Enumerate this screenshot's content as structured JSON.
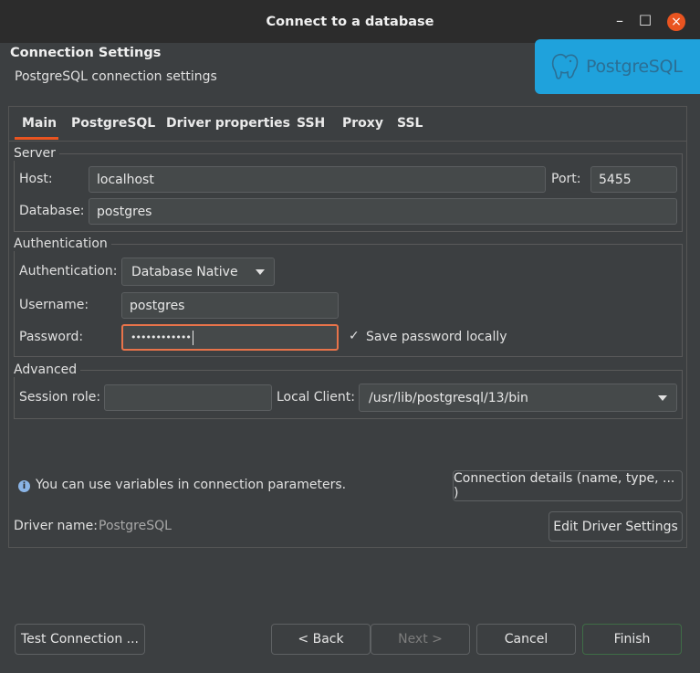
{
  "window": {
    "title": "Connect to a database",
    "minimize_glyph": "–",
    "maximize_glyph": "□",
    "close_glyph": "×"
  },
  "header": {
    "title": "Connection Settings",
    "subtitle": "PostgreSQL connection settings",
    "logo_text": "PostgreSQL",
    "logo_color": "#1fa2dc"
  },
  "tabs": [
    {
      "label": "Main",
      "active": true
    },
    {
      "label": "PostgreSQL"
    },
    {
      "label": "Driver properties"
    },
    {
      "label": "SSH"
    },
    {
      "label": "Proxy"
    },
    {
      "label": "SSL"
    }
  ],
  "server": {
    "group_label": "Server",
    "host_label": "Host:",
    "host_value": "localhost",
    "port_label": "Port:",
    "port_value": "5455",
    "database_label": "Database:",
    "database_value": "postgres"
  },
  "auth": {
    "group_label": "Authentication",
    "auth_label": "Authentication:",
    "auth_value": "Database Native",
    "username_label": "Username:",
    "username_value": "postgres",
    "password_label": "Password:",
    "password_value": "••••••••••••",
    "save_password_label": "Save password locally",
    "save_password_checked": true
  },
  "advanced": {
    "group_label": "Advanced",
    "session_role_label": "Session role:",
    "session_role_value": "",
    "local_client_label": "Local Client:",
    "local_client_value": "/usr/lib/postgresql/13/bin"
  },
  "info": {
    "text": "You can use variables in connection parameters.",
    "connection_details_button": "Connection details (name, type, ... )"
  },
  "driver": {
    "label": "Driver name:",
    "value": "PostgreSQL",
    "edit_button": "Edit Driver Settings"
  },
  "footer": {
    "test_button": "Test Connection ...",
    "back_button": "< Back",
    "next_button": "Next >",
    "cancel_button": "Cancel",
    "finish_button": "Finish"
  },
  "colors": {
    "accent": "#e95420",
    "focus": "#e8734a",
    "background": "#3c3f41"
  }
}
